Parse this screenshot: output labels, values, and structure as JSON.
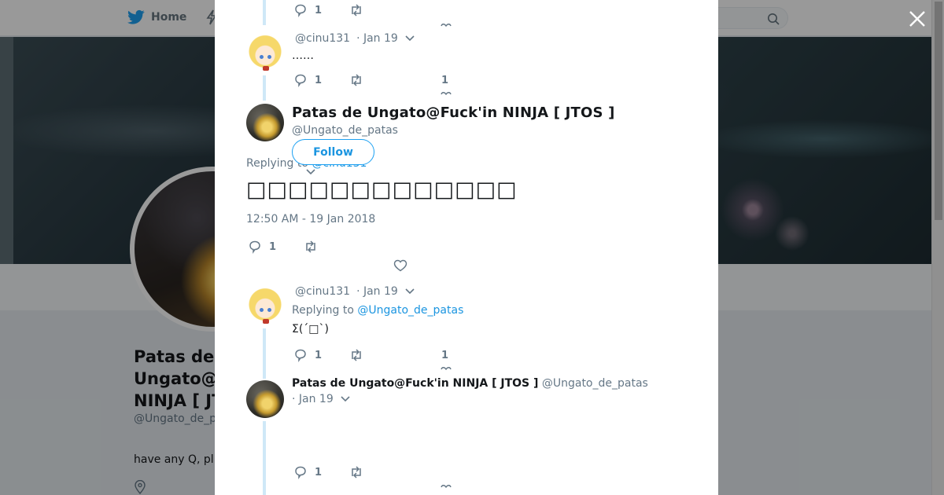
{
  "background": {
    "nav": {
      "home_label": "Home"
    },
    "profile": {
      "name": "Patas de Ungato@Fuck'in NINJA [ JTOS ]",
      "handle": "@Ungato_de_patas",
      "bio": "have any Q, pl"
    }
  },
  "modal": {
    "top_reply": {
      "reply_count": "1"
    },
    "reply_1": {
      "handle": "@cinu131",
      "date": "· Jan 19",
      "text": "……",
      "reply_count": "1",
      "like_count": "1"
    },
    "main_tweet": {
      "name": "Patas de Ungato@Fuck'in NINJA [ JTOS ]",
      "handle": "@Ungato_de_patas",
      "follow_label": "Follow",
      "replying_prefix": "Replying to",
      "replying_handle": "@cinu131",
      "text": "□□□□□□□□□□□□□",
      "timestamp": "12:50 AM - 19 Jan 2018",
      "reply_count": "1"
    },
    "reply_2": {
      "handle": "@cinu131",
      "date": "· Jan 19",
      "replying_prefix": "Replying to",
      "replying_handle": "@Ungato_de_patas",
      "text": "Σ(´□`)",
      "reply_count": "1",
      "like_count": "1"
    },
    "reply_3": {
      "name": "Patas de Ungato@Fuck'in NINJA [ JTOS ]",
      "handle": "@Ungato_de_patas",
      "date": "· Jan 19",
      "reply_count": "1"
    }
  },
  "colors": {
    "accent": "#1da1f2",
    "link": "#1b95e0",
    "muted_text": "#657786",
    "thread_line": "#cfe8f7"
  },
  "icons": [
    "twitter-bird-icon",
    "moments-icon",
    "search-icon",
    "close-icon",
    "reply-icon",
    "retweet-icon",
    "heart-icon",
    "chevron-down-icon",
    "location-icon"
  ]
}
